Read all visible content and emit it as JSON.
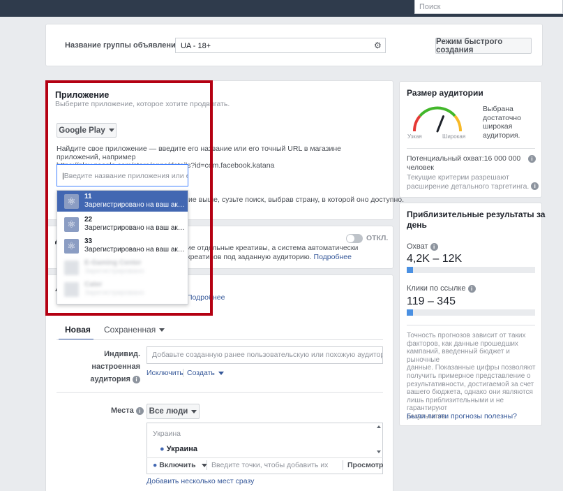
{
  "topbar": {
    "search_placeholder": "Поиск"
  },
  "adset": {
    "label": "Название группы объявлений",
    "value": "UA - 18+",
    "quick_create": "Режим быстрого создания"
  },
  "app": {
    "title": "Приложение",
    "subtitle": "Выберите приложение, которое хотите продвигать.",
    "store_button": "Google Play",
    "instructions_1": "Найдите свое приложение — введите его название или его точный URL в магазине приложений, например",
    "instructions_2": "https://play.google.com/store/apps/details?id=com.facebook.katana",
    "search_placeholder": "Введите название приложения или его URL",
    "note_tail": "ие выше, сузьте поиск, выбрав страну, в которой оно доступно.",
    "dropdown": [
      {
        "name": "11",
        "status": "Зарегистрировано на ваш аккаунт"
      },
      {
        "name": "22",
        "status": "Зарегистрировано на ваш аккаунт"
      },
      {
        "name": "33",
        "status": "Зарегистрировано на ваш аккаунт"
      },
      {
        "name": "E-Gaming Center",
        "status": "Зарегистрировано"
      },
      {
        "name": "Cater",
        "status": "Зарегистрировано"
      }
    ]
  },
  "creative": {
    "toggle_label": "ОТКЛ.",
    "text_1": "ие отдельные креативы, а система автоматически",
    "text_2": "креативов под заданную аудиторию.",
    "more": "Подробнее"
  },
  "audience": {
    "more": "Подробнее",
    "tabs": {
      "new": "Новая",
      "saved": "Сохраненная"
    },
    "custom_label_1": "Индивид. настроенная",
    "custom_label_2": "аудитория",
    "custom_placeholder": "Добавьте созданную ранее пользовательскую или похожую аудиторию",
    "exclude": "Исключить",
    "create": "Создать",
    "places_label": "Места",
    "places_dropdown": "Все люди",
    "location_header": "Украина",
    "location_item": "Украина",
    "include": "Включить",
    "points_placeholder": "Введите точки, чтобы добавить их",
    "browse": "Просмотр",
    "add_multiple": "Добавить несколько мест сразу"
  },
  "audience_size": {
    "title": "Размер аудитории",
    "gauge_narrow": "Узкая",
    "gauge_wide": "Широкая",
    "status_1": "Выбрана",
    "status_2": "достаточно",
    "status_3": "широкая",
    "status_4": "аудитория.",
    "potential_1": "Потенциальный охват:16 000 000",
    "potential_2": "человек",
    "note_1": "Текущие критерии разрешают",
    "note_2": "расширение детального таргетинга.",
    "gauge_level": 0.62
  },
  "results": {
    "title_1": "Приблизительные результаты за",
    "title_2": "день",
    "reach_label": "Охват",
    "reach_value": "4,2K – 12K",
    "reach_fill": 0.05,
    "clicks_label": "Клики по ссылке",
    "clicks_value": "119 – 345",
    "clicks_fill": 0.05,
    "disclaimer": [
      "Точность прогнозов зависит от таких",
      "факторов, как данные прошедших",
      "кампаний, введенный бюджет и рыночные",
      "данные. Показанные цифры позволяют",
      "получить примерное представление о",
      "результативности, достигаемой за счет",
      "вашего бюджета, однако они являются",
      "лишь приблизительными и не гарантируют",
      "результатов."
    ],
    "feedback": "Были ли эти прогнозы полезны?"
  },
  "colors": {
    "accent": "#4a90e2",
    "highlight": "#4267b2",
    "red_frame": "#b40012",
    "topbar": "#2f3b4c"
  }
}
